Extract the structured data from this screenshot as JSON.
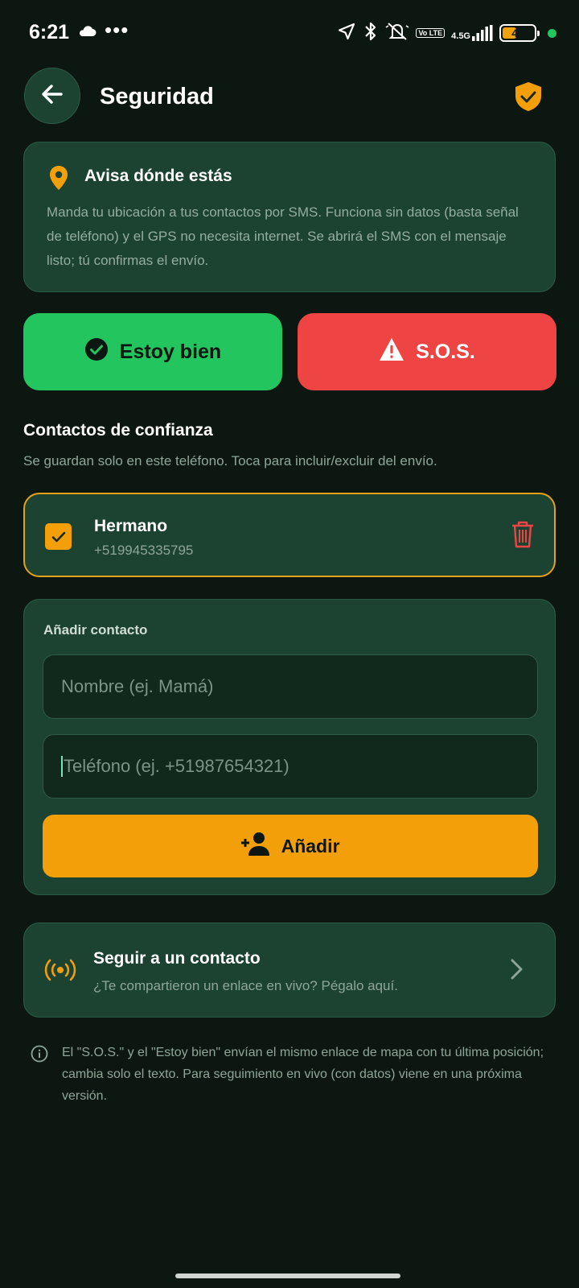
{
  "status_bar": {
    "time": "6:21",
    "dots": "•••",
    "network": "4.5G",
    "lte": "Vo LTE",
    "battery": "45",
    "battery_fraction": 0.45
  },
  "header": {
    "title": "Seguridad"
  },
  "info": {
    "title": "Avisa dónde estás",
    "body": "Manda tu ubicación a tus contactos por SMS. Funciona sin datos (basta señal de teléfono) y el GPS no necesita internet. Se abrirá el SMS con el mensaje listo; tú confirmas el envío."
  },
  "actions": {
    "ok_label": "Estoy bien",
    "sos_label": "S.O.S."
  },
  "contacts": {
    "title": "Contactos de confianza",
    "subtitle": "Se guardan solo en este teléfono. Toca para incluir/excluir del envío.",
    "items": [
      {
        "name": "Hermano",
        "phone": "+519945335795",
        "checked": true
      }
    ]
  },
  "add_contact": {
    "label": "Añadir contacto",
    "name_placeholder": "Nombre (ej. Mamá)",
    "phone_placeholder": "Teléfono (ej. +51987654321)",
    "button_label": "Añadir"
  },
  "follow": {
    "title": "Seguir a un contacto",
    "subtitle": "¿Te compartieron un enlace en vivo? Pégalo aquí."
  },
  "note": {
    "text": "El \"S.O.S.\" y el \"Estoy bien\" envían el mismo enlace de mapa con tu última posición; cambia solo el texto. Para seguimiento en vivo (con datos) viene en una próxima versión."
  },
  "colors": {
    "background": "#0d1712",
    "card": "#1c4232",
    "accent": "#f29f0a",
    "ok": "#22c55e",
    "sos": "#ef4444"
  },
  "icons": {
    "back": "arrow-left-icon",
    "shield": "shield-check-icon",
    "pin": "map-pin-icon",
    "check": "check-circle-icon",
    "warning": "warning-triangle-icon",
    "trash": "trash-icon",
    "add_user": "add-person-icon",
    "broadcast": "broadcast-icon",
    "chevron": "chevron-right-icon",
    "info": "info-icon"
  }
}
